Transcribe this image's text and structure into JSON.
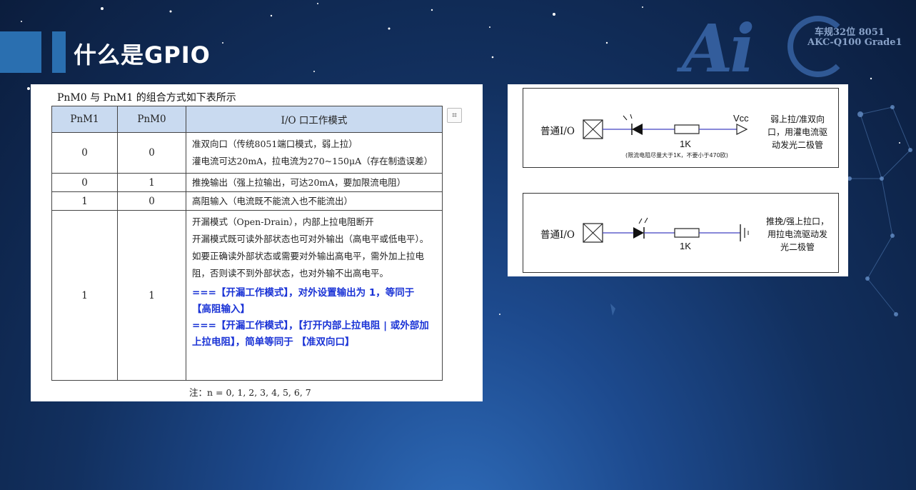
{
  "title": "什么是GPIO",
  "logo": {
    "brand": "Ai",
    "line1": "车规32位 8051",
    "line2": "AKC-Q100 Grade1"
  },
  "table_panel": {
    "caption": "PnM0 与 PnM1 的组合方式如下表所示",
    "headers": [
      "PnM1",
      "PnM0",
      "I/O 口工作模式"
    ],
    "rows": [
      {
        "m1": "0",
        "m0": "0",
        "lines": [
          "准双向口（传统8051端口模式，弱上拉）",
          "灌电流可达20mA，拉电流为270~150μA（存在制造误差）"
        ]
      },
      {
        "m1": "0",
        "m0": "1",
        "lines": [
          "推挽输出（强上拉输出，可达20mA，要加限流电阻）"
        ]
      },
      {
        "m1": "1",
        "m0": "0",
        "lines": [
          "高阻输入（电流既不能流入也不能流出）"
        ]
      },
      {
        "m1": "1",
        "m0": "1",
        "lines": [
          "开漏模式（Open-Drain），内部上拉电阻断开",
          "开漏模式既可读外部状态也可对外输出（高电平或低电平）。如要正确读外部状态或需要对外输出高电平，需外加上拉电阻，否则读不到外部状态，也对外输不出高电平。"
        ],
        "notes": [
          "===【开漏工作模式】，对外设置输出为 1，等同于 【高阻输入】",
          "===【开漏工作模式】，【打开内部上拉电阻 | 或外部加上拉电阻】，简单等同于 【准双向口】"
        ]
      }
    ],
    "footnote": "注：n = 0, 1, 2, 3, 4, 5, 6, 7"
  },
  "circuits": [
    {
      "io_label": "普通I/O",
      "resistor": "1K",
      "vcc": "Vcc",
      "note": "(限流电阻尽量大于1K，不要小于470欧)",
      "side": [
        "弱上拉/准双向",
        "口，用灌电流驱",
        "动发光二极管"
      ]
    },
    {
      "io_label": "普通I/O",
      "resistor": "1K",
      "side": [
        "推挽/强上拉口，",
        "用拉电流驱动发",
        "光二极管"
      ]
    }
  ],
  "colors": {
    "accent": "#2a6fb0",
    "header_fill": "#c9daf0",
    "emphasis": "#1a33d6",
    "wire": "#4040c0"
  }
}
